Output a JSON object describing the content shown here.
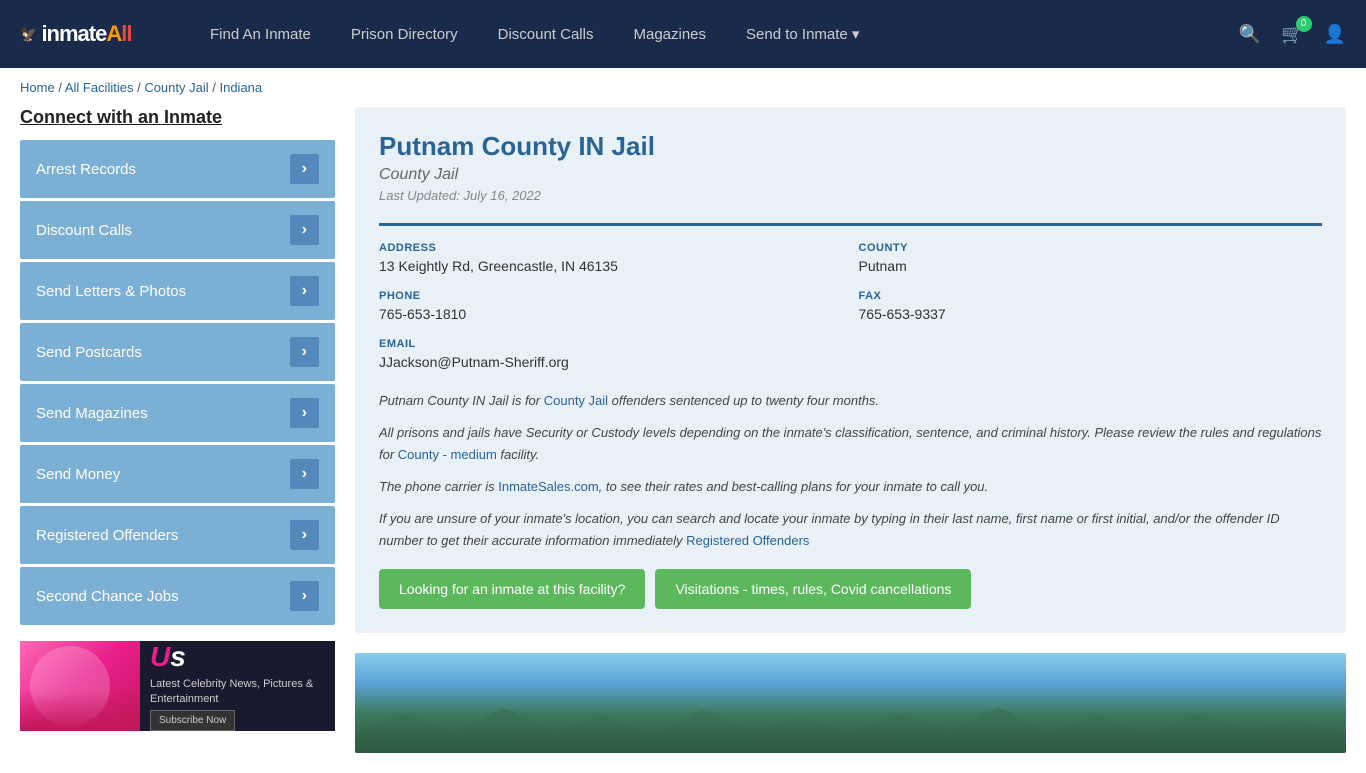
{
  "header": {
    "logo": "inmateAll",
    "logo_icon": "🦅",
    "nav": {
      "find_inmate": "Find An Inmate",
      "prison_directory": "Prison Directory",
      "discount_calls": "Discount Calls",
      "magazines": "Magazines",
      "send_to_inmate": "Send to Inmate ▾"
    },
    "cart_count": "0"
  },
  "breadcrumb": {
    "home": "Home",
    "all_facilities": "All Facilities",
    "county_jail": "County Jail",
    "state": "Indiana"
  },
  "sidebar": {
    "title": "Connect with an Inmate",
    "items": [
      {
        "label": "Arrest Records"
      },
      {
        "label": "Discount Calls"
      },
      {
        "label": "Send Letters & Photos"
      },
      {
        "label": "Send Postcards"
      },
      {
        "label": "Send Magazines"
      },
      {
        "label": "Send Money"
      },
      {
        "label": "Registered Offenders"
      },
      {
        "label": "Second Chance Jobs"
      }
    ],
    "ad": {
      "logo": "Us",
      "headline": "Latest Celebrity News, Pictures & Entertainment",
      "button": "Subscribe Now"
    }
  },
  "facility": {
    "name": "Putnam County IN Jail",
    "type": "County Jail",
    "last_updated": "Last Updated: July 16, 2022",
    "address_label": "ADDRESS",
    "address_value": "13 Keightly Rd, Greencastle, IN 46135",
    "county_label": "COUNTY",
    "county_value": "Putnam",
    "phone_label": "PHONE",
    "phone_value": "765-653-1810",
    "fax_label": "FAX",
    "fax_value": "765-653-9337",
    "email_label": "EMAIL",
    "email_value": "JJackson@Putnam-Sheriff.org",
    "description_1": "Putnam County IN Jail is for County Jail offenders sentenced up to twenty four months.",
    "description_2": "All prisons and jails have Security or Custody levels depending on the inmate's classification, sentence, and criminal history. Please review the rules and regulations for County - medium facility.",
    "description_3": "The phone carrier is InmateSales.com, to see their rates and best-calling plans for your inmate to call you.",
    "description_4": "If you are unsure of your inmate's location, you can search and locate your inmate by typing in their last name, first name or first initial, and/or the offender ID number to get their accurate information immediately Registered Offenders",
    "btn_find": "Looking for an inmate at this facility?",
    "btn_visitations": "Visitations - times, rules, Covid cancellations"
  }
}
